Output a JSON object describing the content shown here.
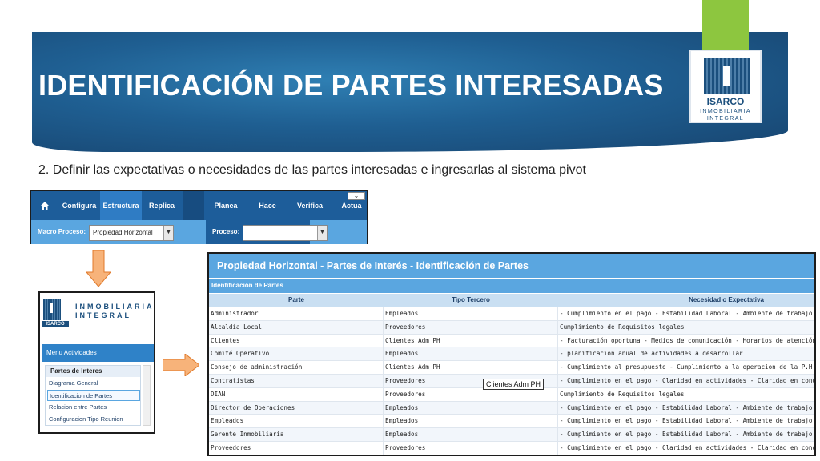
{
  "slide": {
    "title": "IDENTIFICACIÓN DE PARTES INTERESADAS",
    "subtitle": "2. Definir las expectativas o necesidades de las partes interesadas e ingresarlas al sistema pivot",
    "logo": {
      "name": "ISARCO",
      "sub1": "INMOBILIARIA",
      "sub2": "INTEGRAL"
    },
    "colors": {
      "banner": "#1f5f92",
      "accent_green": "#8dc63f",
      "system_blue": "#5aa6e0"
    }
  },
  "nav": {
    "home_icon": "home-icon",
    "items": [
      "Configura",
      "Estructura",
      "Replica",
      "Planea",
      "Hace",
      "Verifica",
      "Actua"
    ],
    "macro_label": "Macro Proceso:",
    "macro_value": "Propiedad Horizontal",
    "proceso_label": "Proceso:",
    "proceso_value": ""
  },
  "menu": {
    "brand_line1": "INMOBILIARIA",
    "brand_line2": "INTEGRAL",
    "logo_text": "ISARCO",
    "bar": "Menu Actividades",
    "group": "Partes de Interes",
    "links": [
      "Diagrama General",
      "Identificacion de Partes",
      "Relacion entre Partes",
      "Configuracion Tipo Reunion"
    ]
  },
  "table": {
    "title": "Propiedad Horizontal  -  Partes de Interés  -  Identificación de Partes",
    "section": "Identificación de Partes",
    "headers": [
      "Parte",
      "Tipo Tercero",
      "Necesidad o Expectativa"
    ],
    "rows": [
      [
        "Administrador",
        "Empleados",
        "- Cumplimiento en el pago - Estabilidad Laboral - Ambiente de trabajo - Bienestar -"
      ],
      [
        "Alcaldía Local",
        "Proveedores",
        "Cumplimiento de Requisitos legales"
      ],
      [
        "Clientes",
        "Clientes Adm PH",
        "- Facturación oportuna - Medios de comunicación - Horarios de atención -Informac"
      ],
      [
        "Comité Operativo",
        "Empleados",
        "- planificacion anual de actividades a desarrollar"
      ],
      [
        "Consejo de administración",
        "Clientes Adm PH",
        "- Cumplimiento al presupuesto - Cumplimiento a la operacion de la P.H."
      ],
      [
        "Contratistas",
        "Proveedores",
        "- Cumplimiento en el pago - Claridad en actividades - Claridad en condiciones - Re"
      ],
      [
        "DIAN",
        "Proveedores",
        "Cumplimiento de Requisitos legales"
      ],
      [
        "Director de Operaciones",
        "Empleados",
        "- Cumplimiento en el pago - Estabilidad Laboral - Ambiente de trabajo - Bienestar -"
      ],
      [
        "Empleados",
        "Empleados",
        "- Cumplimiento en el pago - Estabilidad Laboral - Ambiente de trabajo - Bienestar -"
      ],
      [
        "Gerente Inmobiliaria",
        "Empleados",
        "- Cumplimiento en el pago - Estabilidad Laboral - Ambiente de trabajo - Bienestar -"
      ],
      [
        "Proveedores",
        "Proveedores",
        "- Cumplimiento en el pago - Claridad en actividades - Claridad en condiciones - Re"
      ]
    ],
    "tooltip": "Clientes Adm PH"
  }
}
